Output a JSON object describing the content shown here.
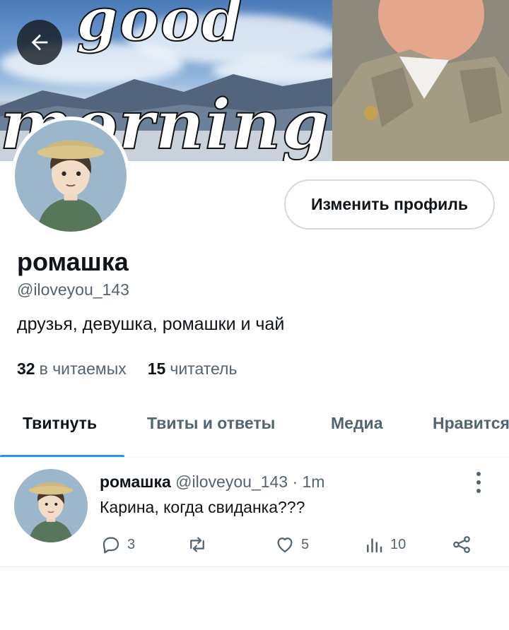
{
  "banner": {
    "line1": "good",
    "line2": "morning"
  },
  "header": {
    "back_icon": "arrow-left-icon"
  },
  "profile": {
    "edit_button": "Изменить профиль",
    "display_name": "ромашка",
    "handle": "@iloveyou_143",
    "bio": "друзья, девушка, ромашки и чай",
    "following_count": "32",
    "following_label": "в читаемых",
    "followers_count": "15",
    "followers_label": "читатель"
  },
  "tabs": [
    {
      "label": "Твитнуть",
      "active": true
    },
    {
      "label": "Твиты и ответы",
      "active": false
    },
    {
      "label": "Медиа",
      "active": false
    },
    {
      "label": "Нравится",
      "active": false
    }
  ],
  "tweet": {
    "name": "ромашка",
    "meta": "@iloveyou_143 · 1m",
    "text": "Карина, когда свиданка???",
    "replies": "3",
    "retweets": "",
    "likes": "5",
    "views": "10"
  },
  "colors": {
    "accent": "#1d9bf0",
    "text_primary": "#0f1419",
    "text_secondary": "#536471"
  }
}
